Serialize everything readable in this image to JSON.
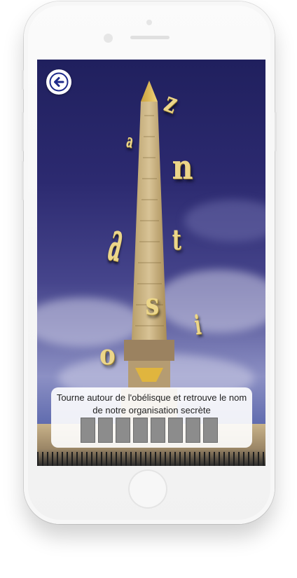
{
  "screen": {
    "back_button_icon": "arrow-left-icon",
    "floating_letters": [
      "z",
      "a",
      "n",
      "a",
      "t",
      "s",
      "i",
      "o"
    ],
    "hint": {
      "text": "Tourne autour de l'obélisque et retrouve le nom de notre organisation secrète",
      "slot_count": 8
    }
  },
  "device": {
    "frame_color": "#f4f4f4",
    "screen_accent": "#2c2a70"
  }
}
